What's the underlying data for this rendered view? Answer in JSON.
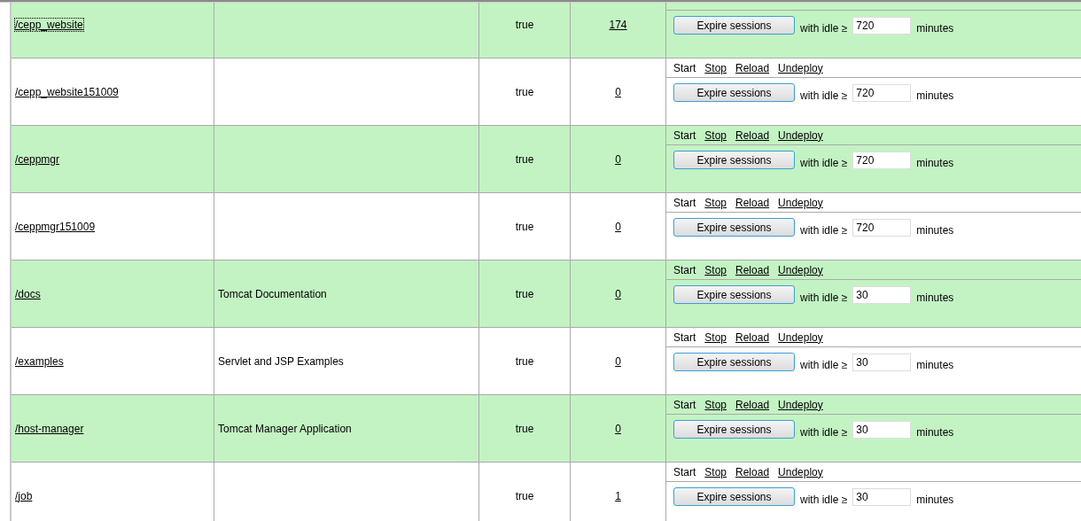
{
  "rows": [
    {
      "path": "/cepp_website",
      "display_name": "",
      "running": "true",
      "sessions": "174",
      "focused": true,
      "expire_button": "Expire sessions",
      "idle_label": "with idle ≥",
      "idle_value": "720",
      "minutes_label": "minutes"
    },
    {
      "path": "/cepp_website151009",
      "display_name": "",
      "running": "true",
      "sessions": "0",
      "focused": false,
      "commands": [
        {
          "label": "Start",
          "link": false
        },
        {
          "label": "Stop",
          "link": true
        },
        {
          "label": "Reload",
          "link": true
        },
        {
          "label": "Undeploy",
          "link": true
        }
      ],
      "expire_button": "Expire sessions",
      "idle_label": "with idle ≥",
      "idle_value": "720",
      "minutes_label": "minutes"
    },
    {
      "path": "/ceppmgr",
      "display_name": "",
      "running": "true",
      "sessions": "0",
      "focused": false,
      "commands": [
        {
          "label": "Start",
          "link": false
        },
        {
          "label": "Stop",
          "link": true
        },
        {
          "label": "Reload",
          "link": true
        },
        {
          "label": "Undeploy",
          "link": true
        }
      ],
      "expire_button": "Expire sessions",
      "idle_label": "with idle ≥",
      "idle_value": "720",
      "minutes_label": "minutes"
    },
    {
      "path": "/ceppmgr151009",
      "display_name": "",
      "running": "true",
      "sessions": "0",
      "focused": false,
      "commands": [
        {
          "label": "Start",
          "link": false
        },
        {
          "label": "Stop",
          "link": true
        },
        {
          "label": "Reload",
          "link": true
        },
        {
          "label": "Undeploy",
          "link": true
        }
      ],
      "expire_button": "Expire sessions",
      "idle_label": "with idle ≥",
      "idle_value": "720",
      "minutes_label": "minutes"
    },
    {
      "path": "/docs",
      "display_name": "Tomcat Documentation",
      "running": "true",
      "sessions": "0",
      "focused": false,
      "commands": [
        {
          "label": "Start",
          "link": false
        },
        {
          "label": "Stop",
          "link": true
        },
        {
          "label": "Reload",
          "link": true
        },
        {
          "label": "Undeploy",
          "link": true
        }
      ],
      "expire_button": "Expire sessions",
      "idle_label": "with idle ≥",
      "idle_value": "30",
      "minutes_label": "minutes"
    },
    {
      "path": "/examples",
      "display_name": "Servlet and JSP Examples",
      "running": "true",
      "sessions": "0",
      "focused": false,
      "commands": [
        {
          "label": "Start",
          "link": false
        },
        {
          "label": "Stop",
          "link": true
        },
        {
          "label": "Reload",
          "link": true
        },
        {
          "label": "Undeploy",
          "link": true
        }
      ],
      "expire_button": "Expire sessions",
      "idle_label": "with idle ≥",
      "idle_value": "30",
      "minutes_label": "minutes"
    },
    {
      "path": "/host-manager",
      "display_name": "Tomcat Manager Application",
      "running": "true",
      "sessions": "0",
      "focused": false,
      "commands": [
        {
          "label": "Start",
          "link": false
        },
        {
          "label": "Stop",
          "link": true
        },
        {
          "label": "Reload",
          "link": true
        },
        {
          "label": "Undeploy",
          "link": true
        }
      ],
      "expire_button": "Expire sessions",
      "idle_label": "with idle ≥",
      "idle_value": "30",
      "minutes_label": "minutes"
    },
    {
      "path": "/job",
      "display_name": "",
      "running": "true",
      "sessions": "1",
      "focused": false,
      "commands": [
        {
          "label": "Start",
          "link": false
        },
        {
          "label": "Stop",
          "link": true
        },
        {
          "label": "Reload",
          "link": true
        },
        {
          "label": "Undeploy",
          "link": true
        }
      ],
      "expire_button": "Expire sessions",
      "idle_label": "with idle ≥",
      "idle_value": "30",
      "minutes_label": "minutes"
    }
  ]
}
